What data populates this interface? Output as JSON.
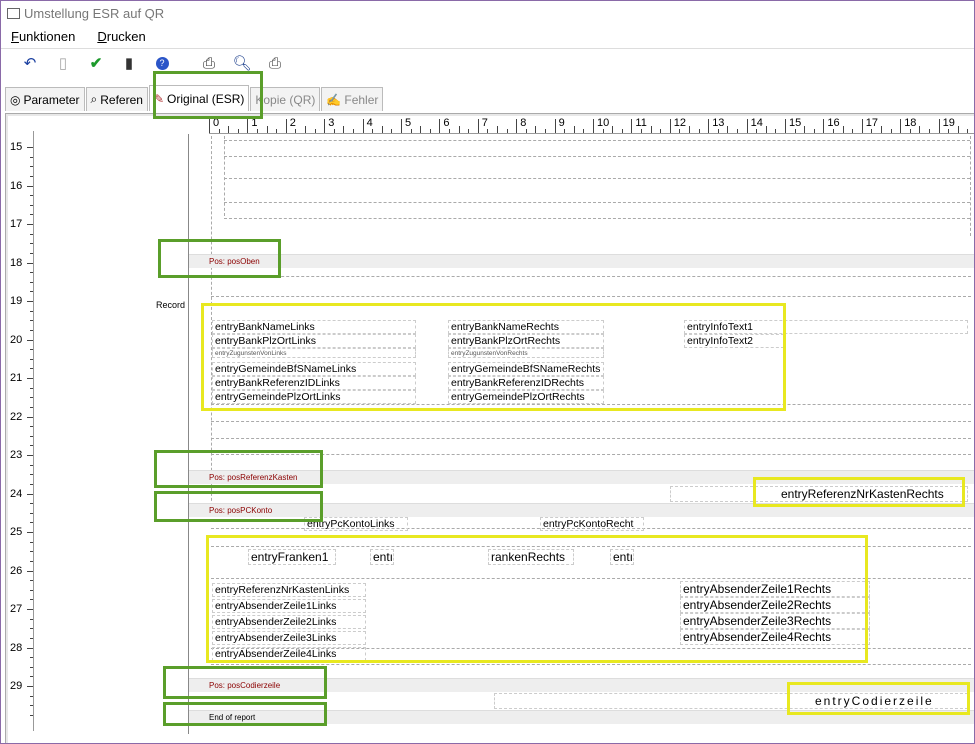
{
  "window": {
    "title": "Umstellung ESR auf QR"
  },
  "menu": {
    "items": [
      "Funktionen",
      "Drucken"
    ]
  },
  "toolbar": {
    "icons": [
      "undo-icon",
      "door-disabled-icon",
      "checkmark-icon",
      "exit-door-icon",
      "help-icon",
      "printer-icon",
      "print-preview-icon",
      "print-setup-icon"
    ]
  },
  "tabs": [
    {
      "label": "Parameter",
      "icon": "binoculars-icon"
    },
    {
      "label": "Referen",
      "icon": "magnifier-icon"
    },
    {
      "label": "Original (ESR)",
      "icon": "pencil-doc-icon"
    },
    {
      "label": "Kopie (QR)",
      "icon": ""
    },
    {
      "label": "Fehler",
      "icon": "edit-icon"
    }
  ],
  "ruler": {
    "h": [
      "0",
      "1",
      "2",
      "3",
      "4",
      "5",
      "6",
      "7",
      "8",
      "9",
      "10",
      "11",
      "12",
      "13",
      "14",
      "15",
      "16",
      "17",
      "18",
      "19"
    ],
    "v": [
      "15",
      "16",
      "17",
      "18",
      "19",
      "20",
      "21",
      "22",
      "23",
      "24",
      "25",
      "26",
      "27",
      "28",
      "29"
    ]
  },
  "record_label": "Record",
  "bands": {
    "pos_oben": "Pos: posOben",
    "pos_ref": "Pos: posReferenzKasten",
    "pos_pc": "Pos: posPCKonto",
    "pos_cod": "Pos: posCodierzeile",
    "end": "End of report"
  },
  "fields": {
    "bank_name_links": "entryBankNameLinks",
    "bank_plz_links": "entryBankPlzOrtLinks",
    "zug_links": "entryZugunstenVonLinks",
    "gem_bfs_links": "entryGemeindeBfSNameLinks",
    "bank_ref_links": "entryBankReferenzIDLinks",
    "gem_plz_links": "entryGemeindePlzOrtLinks",
    "bank_name_rechts": "entryBankNameRechts",
    "bank_plz_rechts": "entryBankPlzOrtRechts",
    "zug_rechts": "entryZugunstenVonRechts",
    "gem_bfs_rechts": "entryGemeindeBfSNameRechts",
    "bank_ref_rechts": "entryBankReferenzIDRechts",
    "gem_plz_rechts": "entryGemeindePlzOrtRechts",
    "info1": "entryInfoText1",
    "info2": "entryInfoText2",
    "ref_kasten_rechts": "entryReferenzNrKastenRechts",
    "pc_konto_links": "entryPcKontoLinks",
    "pc_konto_rechts": "entryPcKontoRecht",
    "franken1": "entryFranken1",
    "entl1": "entı",
    "franken_rechts": "rankenRechts",
    "entl2": "entı",
    "ref_kasten_links": "entryReferenzNrKastenLinks",
    "abs1_links": "entryAbsenderZeile1Links",
    "abs2_links": "entryAbsenderZeile2Links",
    "abs3_links": "entryAbsenderZeile3Links",
    "abs4_links": "entryAbsenderZeile4Links",
    "abs1_rechts": "entryAbsenderZeile1Rechts",
    "abs2_rechts": "entryAbsenderZeile2Rechts",
    "abs3_rechts": "entryAbsenderZeile3Rechts",
    "abs4_rechts": "entryAbsenderZeile4Rechts",
    "codierzeile": "entryCodierzeile"
  },
  "colors": {
    "highlight_green": "#5a9e2a",
    "highlight_yellow": "#e8e820",
    "band_text": "#8b0000"
  }
}
